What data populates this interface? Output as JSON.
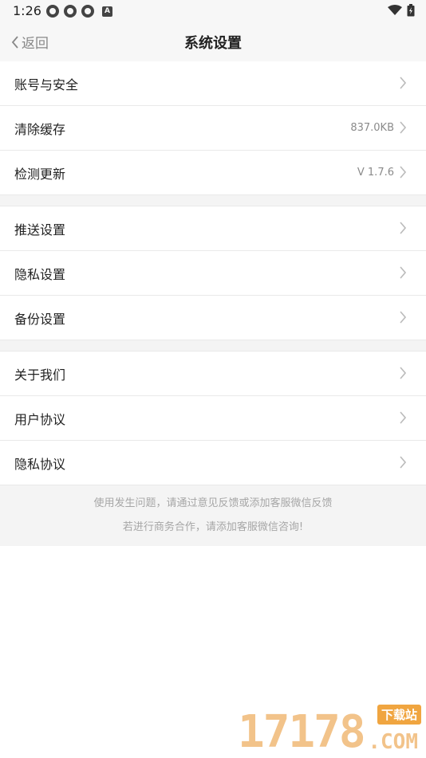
{
  "status_bar": {
    "time": "1:26",
    "notification_icons": [
      "status-app-icon",
      "status-app-icon",
      "status-app-icon",
      "a-badge-icon"
    ],
    "a_badge": "A"
  },
  "nav": {
    "back_label": "返回",
    "title": "系统设置"
  },
  "groups": [
    [
      {
        "label": "账号与安全",
        "value": ""
      },
      {
        "label": "清除缓存",
        "value": "837.0KB"
      },
      {
        "label": "检测更新",
        "value": "V 1.7.6"
      }
    ],
    [
      {
        "label": "推送设置",
        "value": ""
      },
      {
        "label": "隐私设置",
        "value": ""
      },
      {
        "label": "备份设置",
        "value": ""
      }
    ],
    [
      {
        "label": "关于我们",
        "value": ""
      },
      {
        "label": "用户协议",
        "value": ""
      },
      {
        "label": "隐私协议",
        "value": ""
      }
    ]
  ],
  "footer": {
    "line1": "使用发生问题，请通过意见反馈或添加客服微信反馈",
    "line2": "若进行商务合作，请添加客服微信咨询!"
  },
  "watermark": {
    "digits": "17178",
    "badge": "下载站",
    "domain": ".COM"
  },
  "colors": {
    "accent_watermark": "#f0a540",
    "divider": "#e9e9e9",
    "group_gap": "#f4f4f4"
  }
}
